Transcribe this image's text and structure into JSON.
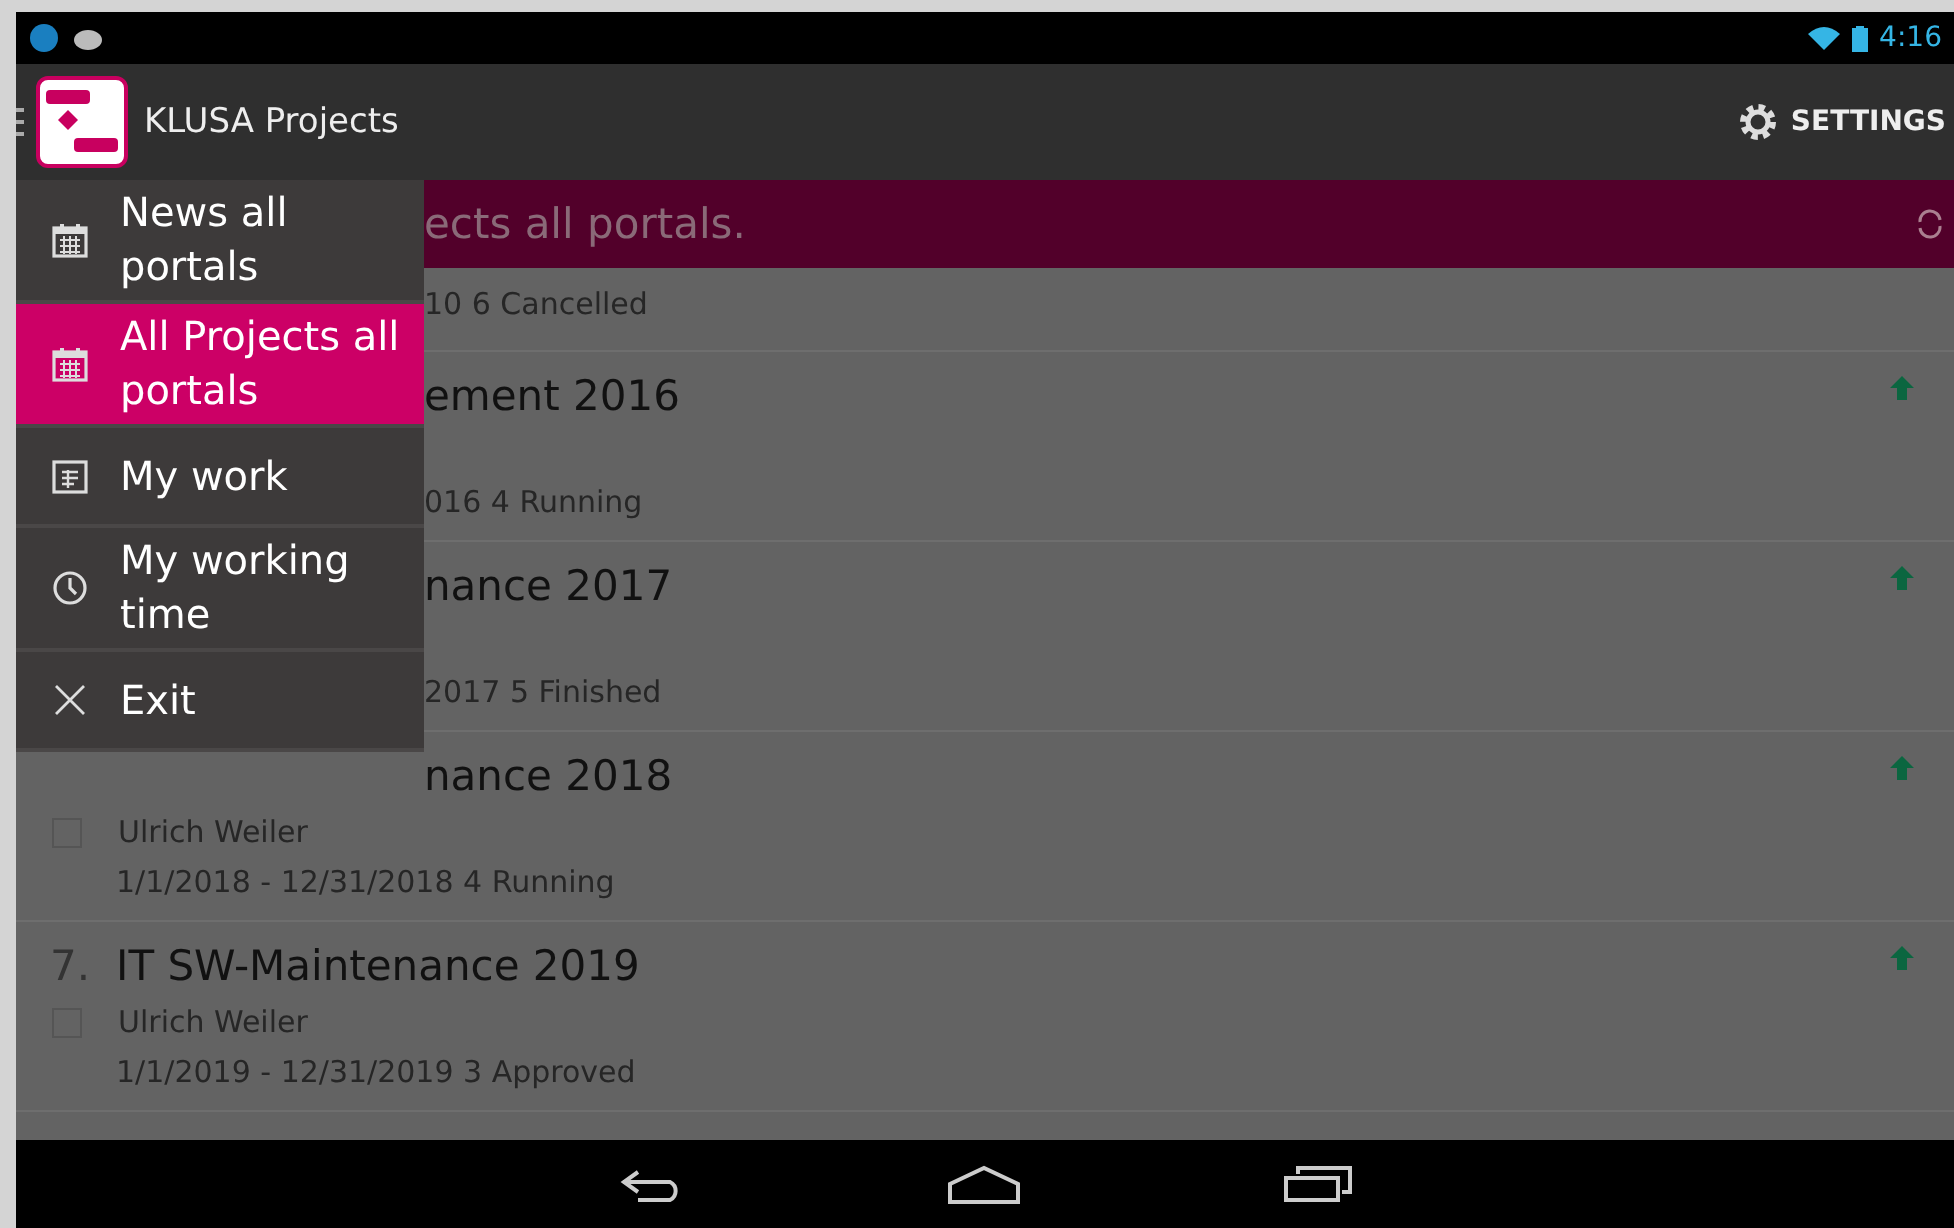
{
  "status_bar": {
    "time": "4:16"
  },
  "action_bar": {
    "title": "KLUSA Projects",
    "settings_label": "SETTINGS"
  },
  "banner": {
    "text": "ects all portals."
  },
  "drawer": {
    "items": [
      {
        "label": "News all portals",
        "kind": "calendar",
        "selected": false
      },
      {
        "label": "All Projects all portals",
        "kind": "calendar",
        "selected": true
      },
      {
        "label": "My work",
        "kind": "planner",
        "selected": false
      },
      {
        "label": "My working time",
        "kind": "clock",
        "selected": false
      },
      {
        "label": "Exit",
        "kind": "close",
        "selected": false
      }
    ]
  },
  "projects": [
    {
      "dates": "10 6 Cancelled",
      "dates_covered": true,
      "arrow": false
    },
    {
      "title": "ement 2016",
      "title_covered": true,
      "dates": "016 4 Running",
      "dates_covered": true,
      "arrow": true
    },
    {
      "title": "nance 2017",
      "title_covered": true,
      "dates": "2017 5 Finished",
      "dates_covered": true,
      "arrow": true
    },
    {
      "title": "nance 2018",
      "title_covered": true,
      "owner": "Ulrich Weiler",
      "checked": false,
      "dates": "1/1/2018 - 12/31/2018 4 Running",
      "dates_covered": false,
      "arrow": true
    },
    {
      "number": "7.",
      "title": "IT SW-Maintenance 2019",
      "title_covered": false,
      "owner": "Ulrich Weiler",
      "checked": false,
      "dates": "1/1/2019 - 12/31/2019 3 Approved",
      "dates_covered": false,
      "arrow": true
    }
  ]
}
